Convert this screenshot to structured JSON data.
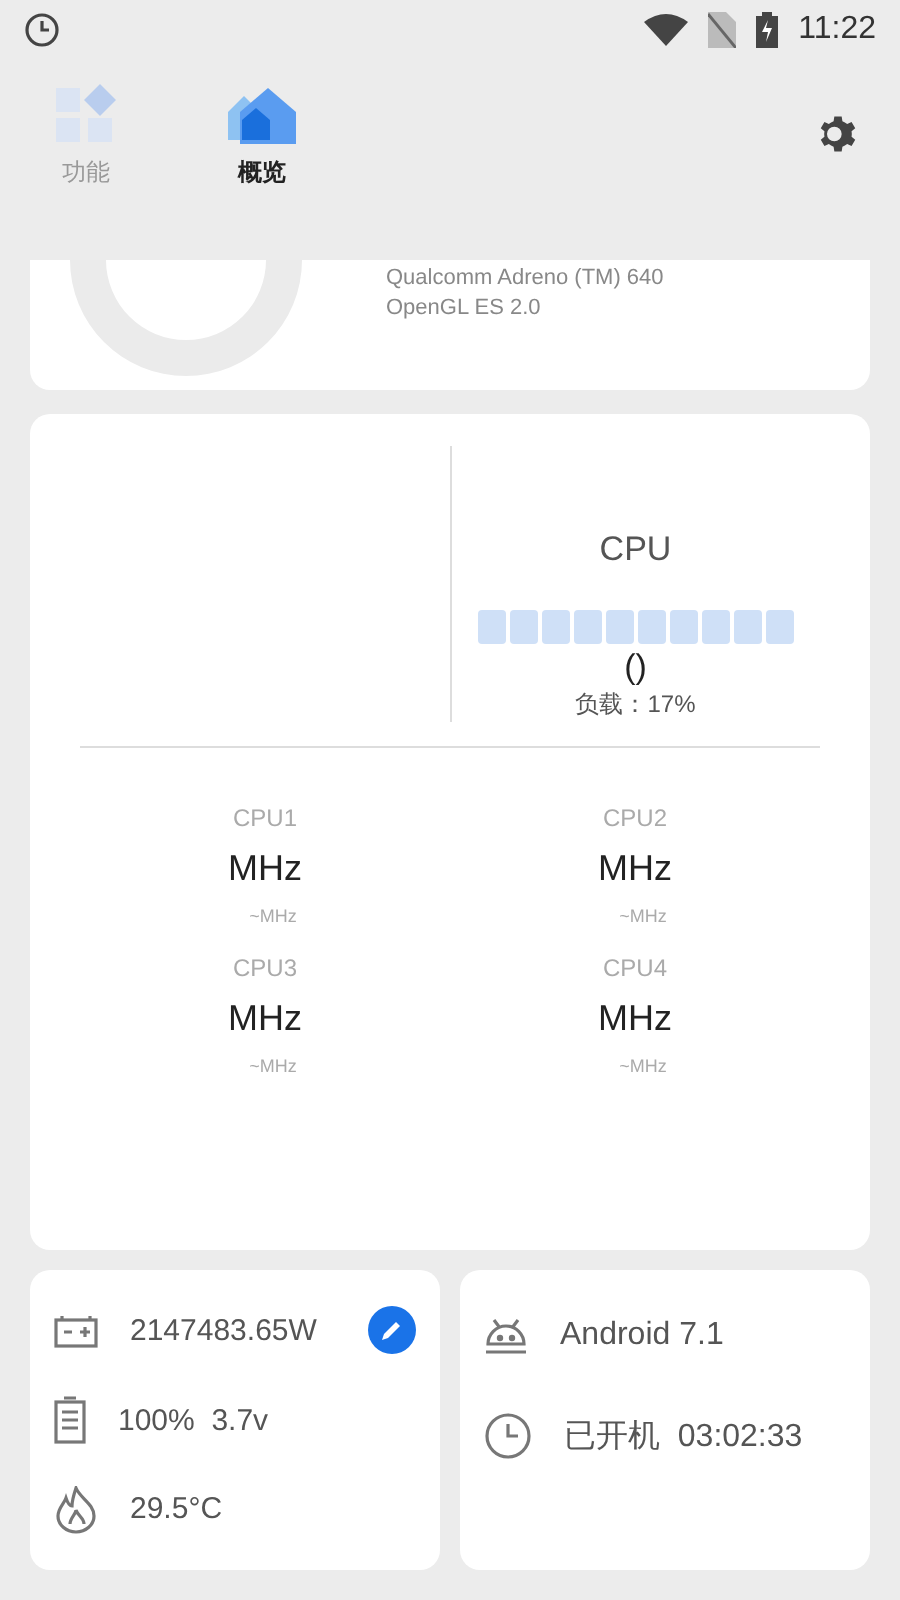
{
  "status_bar": {
    "time": "11:22"
  },
  "tabs": [
    {
      "label": "功能",
      "selected": false,
      "kind": "grid"
    },
    {
      "label": "概览",
      "selected": true,
      "kind": "home"
    }
  ],
  "gpu_card": {
    "lines": [
      "Qualcomm Adreno (TM) 640",
      "OpenGL ES 2.0"
    ]
  },
  "cpu_card": {
    "title": "CPU",
    "value": "()",
    "load": "负载：17%",
    "cores": [
      {
        "name": "CPU1",
        "freq": "MHz",
        "range": "~MHz"
      },
      {
        "name": "CPU2",
        "freq": "MHz",
        "range": "~MHz"
      },
      {
        "name": "CPU3",
        "freq": "MHz",
        "range": "~MHz"
      },
      {
        "name": "CPU4",
        "freq": "MHz",
        "range": "~MHz"
      }
    ]
  },
  "battery_card": {
    "rows": [
      {
        "kind": "power",
        "text": "2147483.65W",
        "editable": true
      },
      {
        "kind": "battery",
        "text": "100%  3.7v",
        "editable": false
      },
      {
        "kind": "temperature",
        "text": "29.5°C",
        "editable": false
      }
    ]
  },
  "system_card": {
    "rows": [
      {
        "kind": "android",
        "text": "Android 7.1"
      },
      {
        "kind": "clock",
        "text": "已开机  03:02:33"
      }
    ]
  }
}
